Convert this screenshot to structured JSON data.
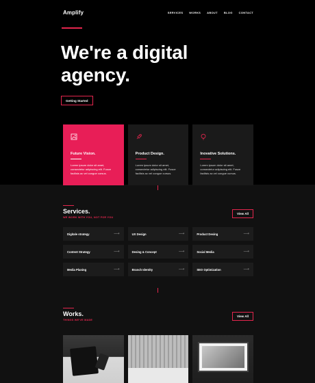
{
  "brand": {
    "name": "Amplify"
  },
  "nav": {
    "items": [
      "SERVICES",
      "WORKS",
      "ABOUT",
      "BLOG",
      "CONTACT"
    ]
  },
  "hero": {
    "title_line1": "We're a digital",
    "title_line2": "agency.",
    "cta_label": "Getting Started"
  },
  "features": [
    {
      "title": "Future Vision.",
      "icon": "image-frame-icon",
      "text": "Lorem ipsum dolor sit amet, consectetur adipiscing elit. Fusce facilisis ac vel congue cursus.",
      "active": true
    },
    {
      "title": "Product Design.",
      "icon": "rocket-icon",
      "text": "Lorem ipsum dolor sit amet, consectetur adipiscing elit. Fusce facilisis ac vel congue cursus.",
      "active": false
    },
    {
      "title": "Inovative Solutions.",
      "icon": "lightbulb-icon",
      "text": "Lorem ipsum dolor sit amet, consectetur adipiscing elit. Fusce facilisis ac vel congue cursus.",
      "active": false
    }
  ],
  "services": {
    "title": "Services.",
    "subtitle": "WE WORK WITH YOU, NOT FOR YOU",
    "view_all": "View All",
    "items": [
      "Digitale strategy",
      "UX Design",
      "Product Desing",
      "Content Strategy",
      "Desing & Concept",
      "Social Media",
      "Media Planing",
      "Branch Identity",
      "SEO Optimization"
    ]
  },
  "works": {
    "title": "Works.",
    "subtitle": "THINGS WE'VE MADE",
    "view_all": "View All"
  },
  "colors": {
    "accent": "#e6264e",
    "card": "#1a1a1a",
    "bg": "#000000",
    "section_bg": "#111111"
  }
}
